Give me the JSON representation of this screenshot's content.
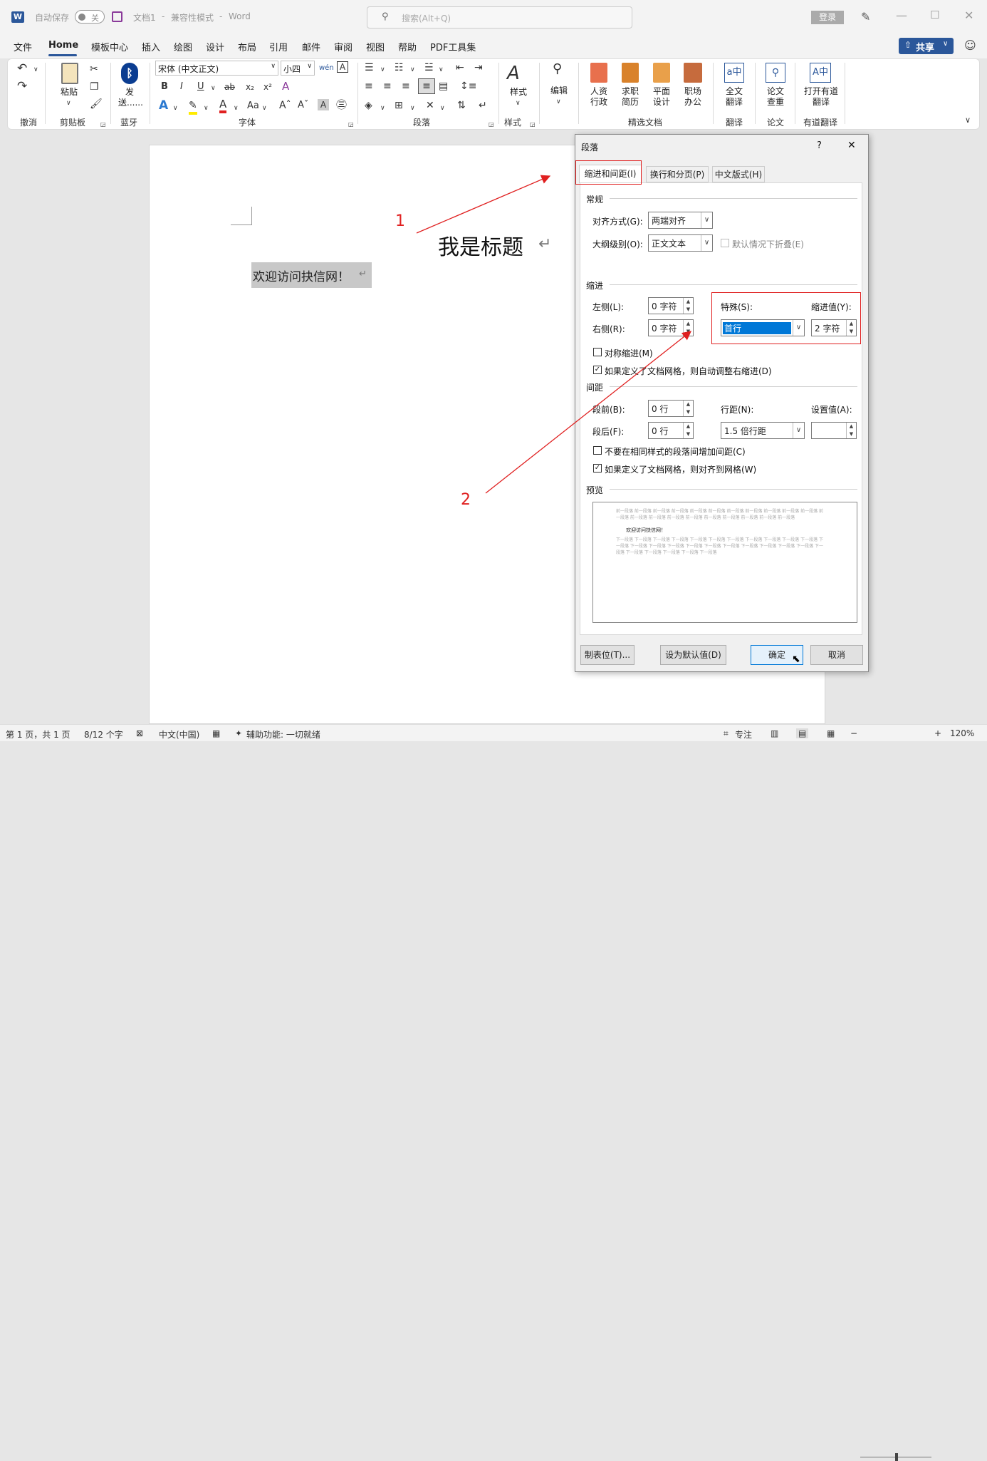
{
  "titlebar": {
    "autosave_label": "自动保存",
    "autosave_state": "关",
    "doc_title": "文档1",
    "compat_mode": "兼容性模式",
    "app_name": "Word",
    "separator": "-",
    "search_placeholder": "搜索(Alt+Q)",
    "login_label": "登录"
  },
  "tabs": [
    "文件",
    "Home",
    "模板中心",
    "插入",
    "绘图",
    "设计",
    "布局",
    "引用",
    "邮件",
    "审阅",
    "视图",
    "帮助",
    "PDF工具集"
  ],
  "share_label": "共享",
  "ribbon": {
    "font_name": "宋体 (中文正文)",
    "font_size": "小四",
    "groups": [
      "撤消",
      "剪贴板",
      "蓝牙",
      "字体",
      "段落",
      "样式",
      "精选文档",
      "翻译",
      "论文",
      "有道翻译"
    ],
    "paste_label": "粘贴",
    "send_label": "发送......",
    "styles_label": "样式",
    "edit_label": "编辑",
    "hr_label": "人资行政",
    "resume_label": "求职简历",
    "design_label": "平面设计",
    "office_label": "职场办公",
    "fulltranslate_label": "全文翻译",
    "papercheck_label": "论文查重",
    "youdao_label": "打开有道翻译"
  },
  "document": {
    "heading": "我是标题",
    "body_text": "欢迎访问抉信网！",
    "annotation_1": "1",
    "annotation_2": "2"
  },
  "dialog": {
    "title": "段落",
    "help": "?",
    "close": "✕",
    "tabs": [
      "缩进和间距(I)",
      "换行和分页(P)",
      "中文版式(H)"
    ],
    "section_general": "常规",
    "align_label": "对齐方式(G):",
    "align_value": "两端对齐",
    "outline_label": "大纲级别(O):",
    "outline_value": "正文文本",
    "collapse_label": "默认情况下折叠(E)",
    "section_indent": "缩进",
    "left_label": "左侧(L):",
    "left_value": "0 字符",
    "right_label": "右侧(R):",
    "right_value": "0 字符",
    "special_label": "特殊(S):",
    "special_value": "首行",
    "indent_by_label": "缩进值(Y):",
    "indent_by_value": "2 字符",
    "mirror_label": "对称缩进(M)",
    "auto_adjust_label": "如果定义了文档网格，则自动调整右缩进(D)",
    "section_spacing": "间距",
    "before_label": "段前(B):",
    "before_value": "0 行",
    "after_label": "段后(F):",
    "after_value": "0 行",
    "line_spacing_label": "行距(N):",
    "line_spacing_value": "1.5 倍行距",
    "at_label": "设置值(A):",
    "at_value": "",
    "no_space_label": "不要在相同样式的段落间增加间距(C)",
    "snap_grid_label": "如果定义了文档网格，则对齐到网格(W)",
    "section_preview": "预览",
    "preview_prev": "前一段落 前一段落 前一段落 前一段落 前一段落 前一段落 前一段落 前一段落 前一段落 前一段落 前一段落 前一段落 前一段落 前一段落 前一段落 前一段落 前一段落 前一段落 前一段落 前一段落 前一段落",
    "preview_sample": "欢迎访问抉信网！",
    "preview_next": "下一段落 下一段落 下一段落 下一段落 下一段落 下一段落 下一段落 下一段落 下一段落 下一段落 下一段落 下一段落 下一段落 下一段落 下一段落 下一段落 下一段落 下一段落 下一段落 下一段落 下一段落 下一段落 下一段落 下一段落 下一段落 下一段落 下一段落 下一段落",
    "tabs_button": "制表位(T)...",
    "default_button": "设为默认值(D)",
    "ok_button": "确定",
    "cancel_button": "取消"
  },
  "statusbar": {
    "page": "第 1 页，共 1 页",
    "words": "8/12 个字",
    "language": "中文(中国)",
    "accessibility": "辅助功能: 一切就绪",
    "focus": "专注",
    "zoom": "120%"
  },
  "colors": {
    "accent": "#2b579a",
    "annotation": "#e02020",
    "selection": "#0078d7"
  }
}
